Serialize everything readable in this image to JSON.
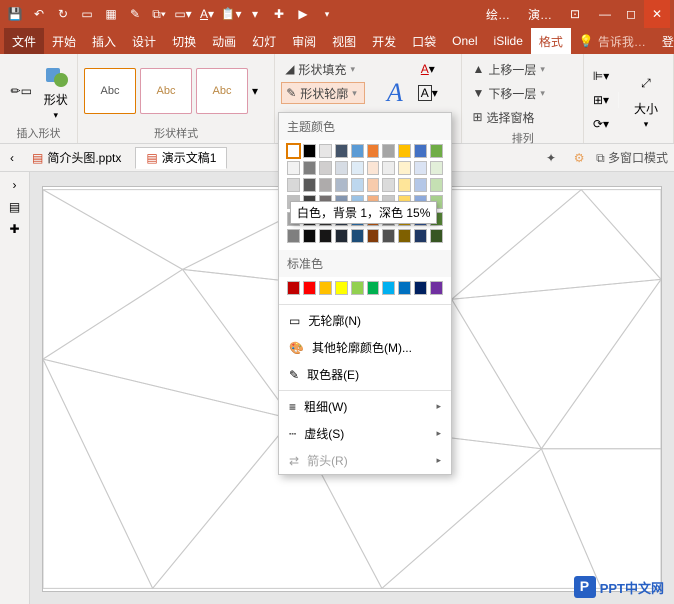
{
  "qat_icons": [
    "save",
    "undo",
    "redo",
    "new",
    "table",
    "brush",
    "clone",
    "box",
    "font",
    "paste",
    "layout",
    "add",
    "present"
  ],
  "title": {
    "context": "绘…",
    "doc": "演…"
  },
  "window_controls": [
    "ribbon-toggle",
    "minimize",
    "maximize",
    "close"
  ],
  "tabs": {
    "file": "文件",
    "items": [
      "开始",
      "插入",
      "设计",
      "切换",
      "动画",
      "幻灯",
      "审阅",
      "视图",
      "开发",
      "口袋",
      "Onel",
      "iSlide"
    ],
    "active": "格式",
    "tell": "告诉我…",
    "login": "登录"
  },
  "ribbon": {
    "insert_shape": {
      "label": "形状",
      "group": "插入形状"
    },
    "shape_styles": {
      "items": [
        "Abc",
        "Abc",
        "Abc"
      ],
      "group": "形状样式"
    },
    "fill": "形状填充",
    "outline": "形状轮廓",
    "wordart_group": "排列",
    "arrange": {
      "bring_fwd": "上移一层",
      "send_back": "下移一层",
      "selection_pane": "选择窗格"
    },
    "size": "大小"
  },
  "documents": {
    "back": "‹",
    "tabs": [
      {
        "name": "简介头图.pptx",
        "active": false
      },
      {
        "name": "演示文稿1",
        "active": true
      }
    ],
    "multi_window": "多窗口模式"
  },
  "dropdown": {
    "theme_header": "主题颜色",
    "theme_row1": [
      "#ffffff",
      "#000000",
      "#e7e6e6",
      "#44546a",
      "#5b9bd5",
      "#ed7d31",
      "#a5a5a5",
      "#ffc000",
      "#4472c4",
      "#70ad47"
    ],
    "theme_tints": [
      [
        "#f2f2f2",
        "#7f7f7f",
        "#d0cece",
        "#d6dce4",
        "#deebf6",
        "#fbe5d5",
        "#ededed",
        "#fff2cc",
        "#dae3f3",
        "#e2efd9"
      ],
      [
        "#d8d8d8",
        "#595959",
        "#aeabab",
        "#adb9ca",
        "#bdd7ee",
        "#f7cbac",
        "#dbdbdb",
        "#fee599",
        "#b4c7e7",
        "#c5e0b3"
      ],
      [
        "#bfbfbf",
        "#3f3f3f",
        "#757070",
        "#8496b0",
        "#9cc3e5",
        "#f4b183",
        "#c9c9c9",
        "#ffd965",
        "#8eaadb",
        "#a8d08d"
      ],
      [
        "#a5a5a5",
        "#262626",
        "#3a3838",
        "#323f4f",
        "#2e75b5",
        "#c55a11",
        "#7b7b7b",
        "#bf9000",
        "#2f5496",
        "#538135"
      ],
      [
        "#7f7f7f",
        "#0c0c0c",
        "#171616",
        "#222a35",
        "#1e4e79",
        "#833c0b",
        "#525252",
        "#7f6000",
        "#1f3864",
        "#375623"
      ]
    ],
    "selected": {
      "row": -1,
      "col": 0
    },
    "tooltip": "白色，背景 1，深色 15%",
    "standard_header": "标准色",
    "standard": [
      "#c00000",
      "#ff0000",
      "#ffc000",
      "#ffff00",
      "#92d050",
      "#00b050",
      "#00b0f0",
      "#0070c0",
      "#002060",
      "#7030a0"
    ],
    "no_outline": "无轮廓(N)",
    "more_colors": "其他轮廓颜色(M)...",
    "eyedropper": "取色器(E)",
    "weight": "粗细(W)",
    "dashes": "虚线(S)",
    "arrows": "箭头(R)"
  },
  "watermark": "PPT中文网"
}
